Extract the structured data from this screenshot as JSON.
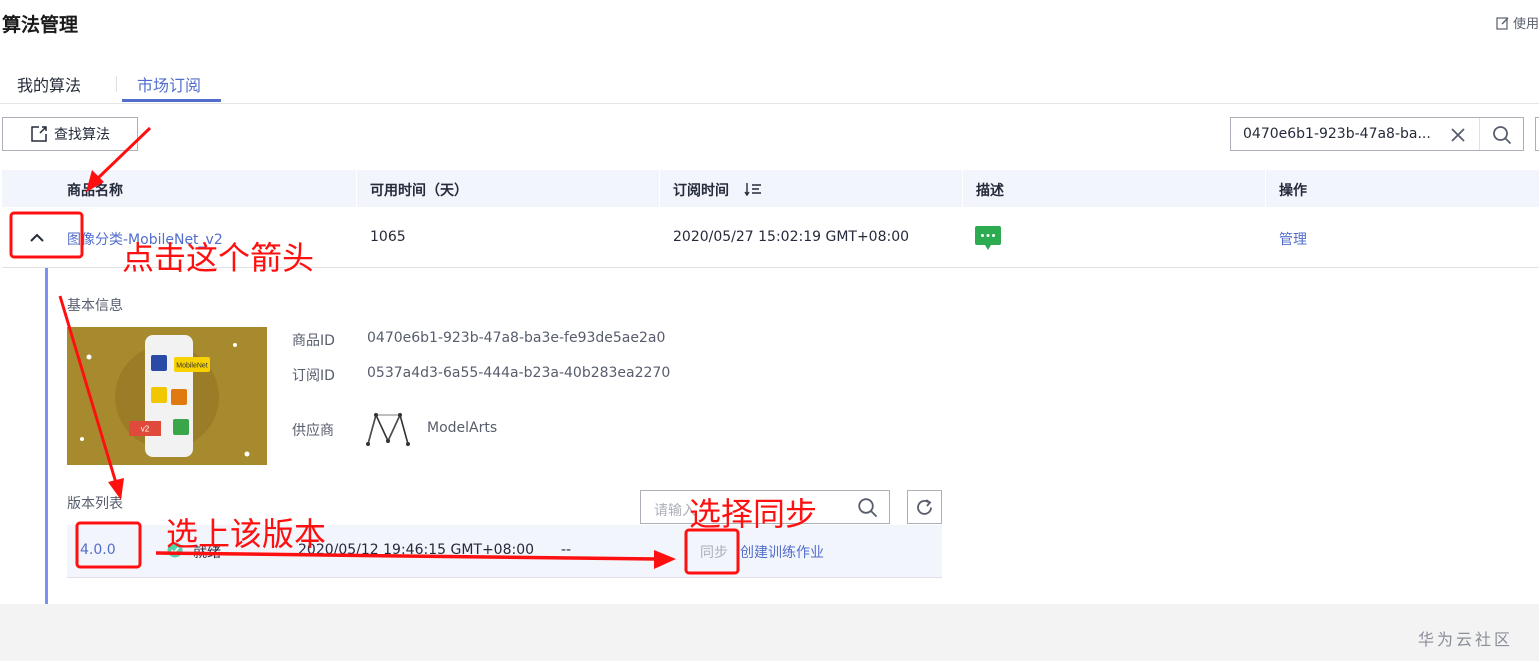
{
  "page": {
    "title": "算法管理",
    "guide_label": "使用"
  },
  "tabs": [
    {
      "label": "我的算法",
      "active": false
    },
    {
      "label": "市场订阅",
      "active": true
    }
  ],
  "toolbar": {
    "find_label": "查找算法",
    "search_value": "0470e6b1-923b-47a8-ba..."
  },
  "table": {
    "columns": [
      "商品名称",
      "可用时间（天）",
      "订阅时间",
      "描述",
      "操作"
    ],
    "row": {
      "name": "图像分类-MobileNet_v2",
      "available_days": "1065",
      "subscribe_time": "2020/05/27 15:02:19 GMT+08:00",
      "action": "管理"
    }
  },
  "detail": {
    "basic_title": "基本信息",
    "thumb_badge_mobilenet": "MobileNet",
    "thumb_badge_v2": "v2",
    "product_id_label": "商品ID",
    "product_id": "0470e6b1-923b-47a8-ba3e-fe93de5ae2a0",
    "subscription_id_label": "订阅ID",
    "subscription_id": "0537a4d3-6a55-444a-b23a-40b283ea2270",
    "provider_label": "供应商",
    "provider": "ModelArts",
    "version_list_title": "版本列表",
    "version_search_placeholder": "请输入",
    "version": {
      "number": "4.0.0",
      "status": "就绪",
      "time": "2020/05/12 19:46:15 GMT+08:00",
      "desc": "--",
      "sync": "同步",
      "create_job": "创建训练作业"
    }
  },
  "annotations": {
    "click_arrow": "点击这个箭头",
    "select_version": "选上该版本",
    "select_sync": "选择同步"
  },
  "footer": "华为云社区",
  "colors": {
    "accent": "#526ecc",
    "annotation": "#ff1010",
    "status_ok": "#50d4ab",
    "desc_icon": "#2dab51"
  }
}
